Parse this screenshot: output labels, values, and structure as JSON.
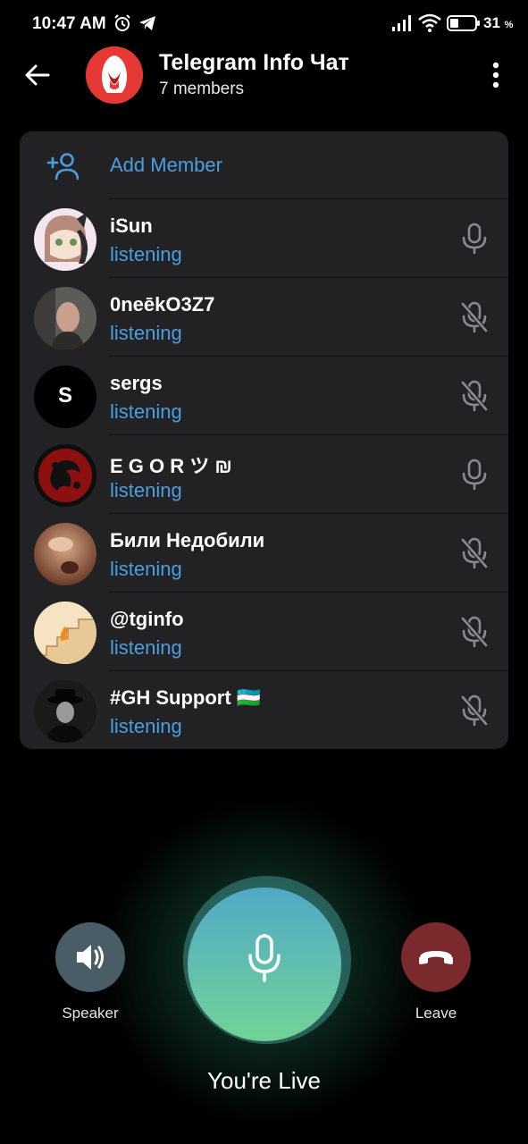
{
  "status_bar": {
    "time": "10:47 AM",
    "battery_percent": "31",
    "battery_suffix": "%"
  },
  "header": {
    "title": "Telegram Info Чат",
    "subtitle": "7 members"
  },
  "panel": {
    "add_member_label": "Add Member",
    "participants": [
      {
        "name": "iSun",
        "status": "listening",
        "mic": "mic-icon"
      },
      {
        "name": "0neēkO3Z7",
        "status": "listening",
        "mic": "mic-muted-icon"
      },
      {
        "name": "sergs",
        "status": "listening",
        "mic": "mic-muted-icon",
        "initial": "S"
      },
      {
        "name": "E G O R ツ ₪",
        "status": "listening",
        "mic": "mic-icon"
      },
      {
        "name": "Били Недобили",
        "status": "listening",
        "mic": "mic-muted-icon"
      },
      {
        "name": "@tginfo",
        "status": "listening",
        "mic": "mic-muted-icon"
      },
      {
        "name": "#GH Support 🇺🇿",
        "status": "listening",
        "mic": "mic-muted-icon"
      }
    ]
  },
  "controls": {
    "speaker_label": "Speaker",
    "leave_label": "Leave",
    "live_label": "You're Live"
  },
  "colors": {
    "accent": "#4a9ee0",
    "card_bg": "#222224",
    "leave_bg": "#7a2a2d",
    "speaker_bg": "#4a5c66"
  }
}
